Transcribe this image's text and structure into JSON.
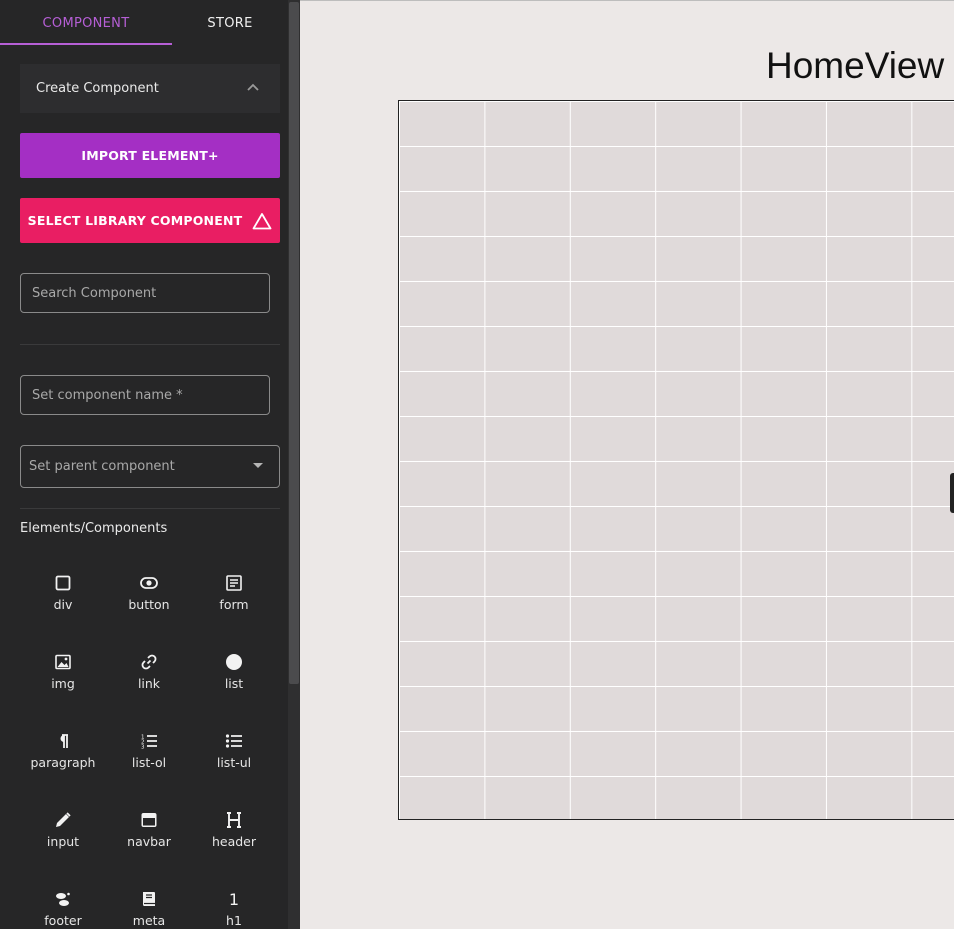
{
  "tabs": [
    {
      "label": "COMPONENT",
      "active": true
    },
    {
      "label": "STORE",
      "active": false
    }
  ],
  "expander": {
    "label": "Create Component"
  },
  "buttons": {
    "import": "IMPORT ELEMENT+",
    "library": "SELECT LIBRARY COMPONENT"
  },
  "inputs": {
    "search_placeholder": "Search Component",
    "name_placeholder": "Set component name *",
    "parent_placeholder": "Set parent component"
  },
  "elements_title": "Elements/Components",
  "elements": [
    {
      "label": "div",
      "icon": "square-outline-icon"
    },
    {
      "label": "button",
      "icon": "toggle-icon"
    },
    {
      "label": "form",
      "icon": "form-icon"
    },
    {
      "label": "img",
      "icon": "image-icon"
    },
    {
      "label": "link",
      "icon": "link-icon"
    },
    {
      "label": "list",
      "icon": "circle-icon"
    },
    {
      "label": "paragraph",
      "icon": "pilcrow-icon"
    },
    {
      "label": "list-ol",
      "icon": "ordered-list-icon"
    },
    {
      "label": "list-ul",
      "icon": "unordered-list-icon"
    },
    {
      "label": "input",
      "icon": "pencil-icon"
    },
    {
      "label": "navbar",
      "icon": "navbar-icon"
    },
    {
      "label": "header",
      "icon": "header-icon"
    },
    {
      "label": "footer",
      "icon": "footprint-icon"
    },
    {
      "label": "meta",
      "icon": "book-icon"
    },
    {
      "label": "h1",
      "icon": "numeral-one-icon"
    }
  ],
  "canvas": {
    "title": "HomeView"
  },
  "colors": {
    "accent": "#b65fd6",
    "import_button": "#a42fc4",
    "library_button": "#e91e63",
    "sidebar_bg": "#262627",
    "canvas_bg": "#ece8e7",
    "grid_bg": "#e0dada"
  }
}
